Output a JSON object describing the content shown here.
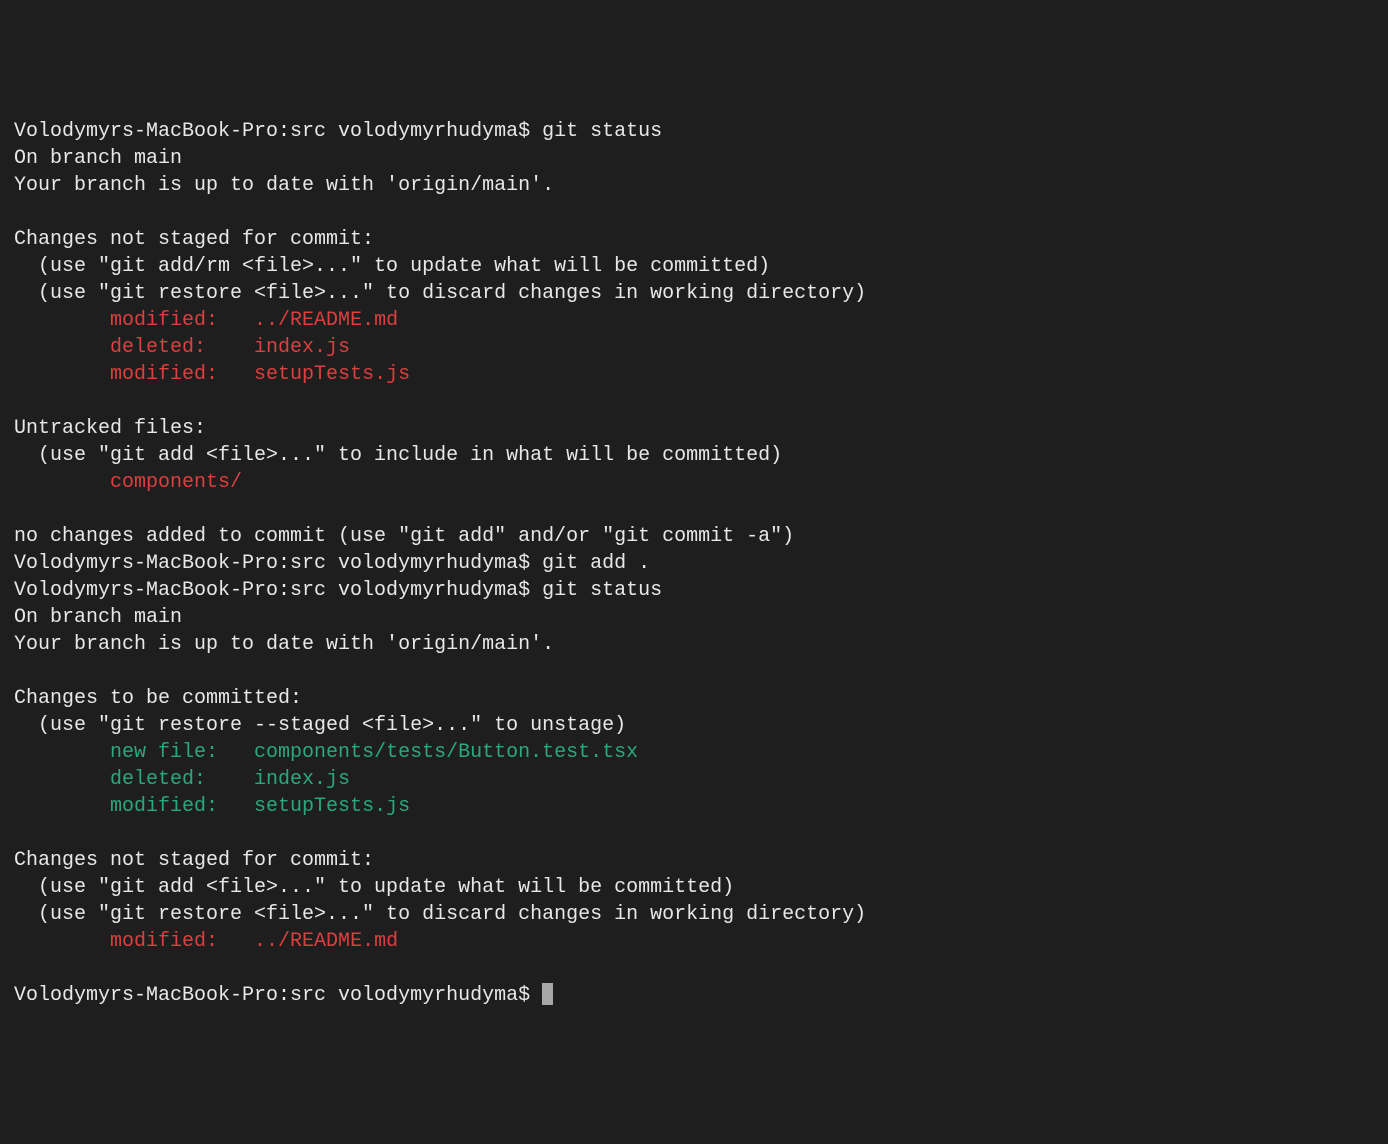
{
  "prompt": "Volodymyrs-MacBook-Pro:src volodymyrhudyma$ ",
  "cmd_git_status": "git status",
  "cmd_git_add": "git add .",
  "branch_line": "On branch main",
  "up_to_date_line": "Your branch is up to date with 'origin/main'.",
  "changes_not_staged_header": "Changes not staged for commit:",
  "hint_add_rm": "  (use \"git add/rm <file>...\" to update what will be committed)",
  "hint_add": "  (use \"git add <file>...\" to update what will be committed)",
  "hint_restore": "  (use \"git restore <file>...\" to discard changes in working directory)",
  "unstaged_1_indent": "        ",
  "unstaged_1_status": "modified:   ",
  "unstaged_1_file": "../README.md",
  "unstaged_2_indent": "        ",
  "unstaged_2_status": "deleted:    ",
  "unstaged_2_file": "index.js",
  "unstaged_3_indent": "        ",
  "unstaged_3_status": "modified:   ",
  "unstaged_3_file": "setupTests.js",
  "untracked_header": "Untracked files:",
  "hint_include": "  (use \"git add <file>...\" to include in what will be committed)",
  "untracked_indent": "        ",
  "untracked_file": "components/",
  "no_changes_line": "no changes added to commit (use \"git add\" and/or \"git commit -a\")",
  "changes_to_be_committed_header": "Changes to be committed:",
  "hint_unstage": "  (use \"git restore --staged <file>...\" to unstage)",
  "staged_1_indent": "        ",
  "staged_1_status": "new file:   ",
  "staged_1_file": "components/tests/Button.test.tsx",
  "staged_2_indent": "        ",
  "staged_2_status": "deleted:    ",
  "staged_2_file": "index.js",
  "staged_3_indent": "        ",
  "staged_3_status": "modified:   ",
  "staged_3_file": "setupTests.js",
  "unstaged_b_indent": "        ",
  "unstaged_b_status": "modified:   ",
  "unstaged_b_file": "../README.md"
}
